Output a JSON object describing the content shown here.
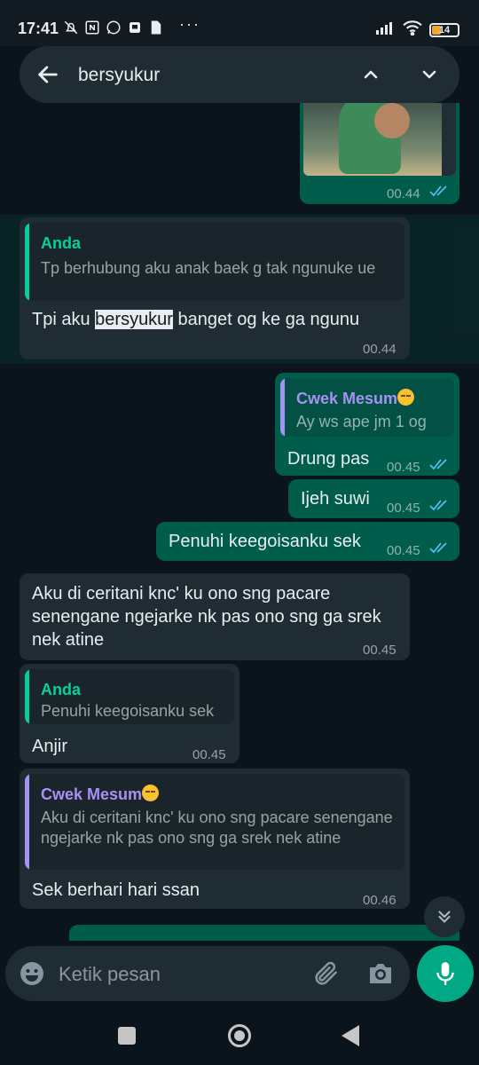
{
  "status_bar": {
    "time": "17:41",
    "battery": "14",
    "icons": [
      "alarm-off-icon",
      "nfc-icon",
      "whatsapp-icon",
      "sim-icon",
      "file-icon",
      "more-dots-icon",
      "signal-icon",
      "wifi-icon",
      "battery-icon"
    ],
    "dots": "···"
  },
  "search": {
    "query": "bersyukur"
  },
  "messages": [
    {
      "id": "m1",
      "direction": "outgoing",
      "type": "image",
      "time": "00.44",
      "read": true
    },
    {
      "id": "m2",
      "direction": "incoming",
      "quote_name": "Anda",
      "quote_text": "Tp berhubung aku anak baek g tak ngunuke ue",
      "text_before": "Tpi aku ",
      "text_match": "bersyukur",
      "text_after": " banget og ke ga ngunu",
      "time": "00.44",
      "highlighted": true
    },
    {
      "id": "m3",
      "direction": "outgoing",
      "quote_name": "Cwek Mesum",
      "quote_text": "Ay ws ape jm 1 og",
      "text": "Drung pas",
      "time": "00.45",
      "read": true
    },
    {
      "id": "m4",
      "direction": "outgoing",
      "text": "Ijeh suwi",
      "time": "00.45",
      "read": true
    },
    {
      "id": "m5",
      "direction": "outgoing",
      "text": "Penuhi keegoisanku sek",
      "time": "00.45",
      "read": true
    },
    {
      "id": "m6",
      "direction": "incoming",
      "text": "Aku di ceritani knc' ku ono sng pacare senengane ngejarke nk pas ono sng ga srek nek atine",
      "time": "00.45"
    },
    {
      "id": "m7",
      "direction": "incoming",
      "quote_name": "Anda",
      "quote_text": "Penuhi keegoisanku sek",
      "text": "Anjir",
      "time": "00.45"
    },
    {
      "id": "m8",
      "direction": "incoming",
      "quote_name": "Cwek Mesum",
      "quote_text": "Aku di ceritani knc' ku ono sng pacare senengane ngejarke nk pas ono sng ga srek nek atine",
      "text": "Sek berhari hari ssan",
      "time": "00.46"
    }
  ],
  "composer": {
    "placeholder": "Ketik pesan"
  },
  "colors": {
    "background": "#0b141a",
    "incoming": "#202c33",
    "outgoing": "#005c4b",
    "accent": "#00a884",
    "quote_self": "#06cf9c",
    "quote_contact": "#a791f4",
    "read_ticks": "#53bdeb"
  }
}
